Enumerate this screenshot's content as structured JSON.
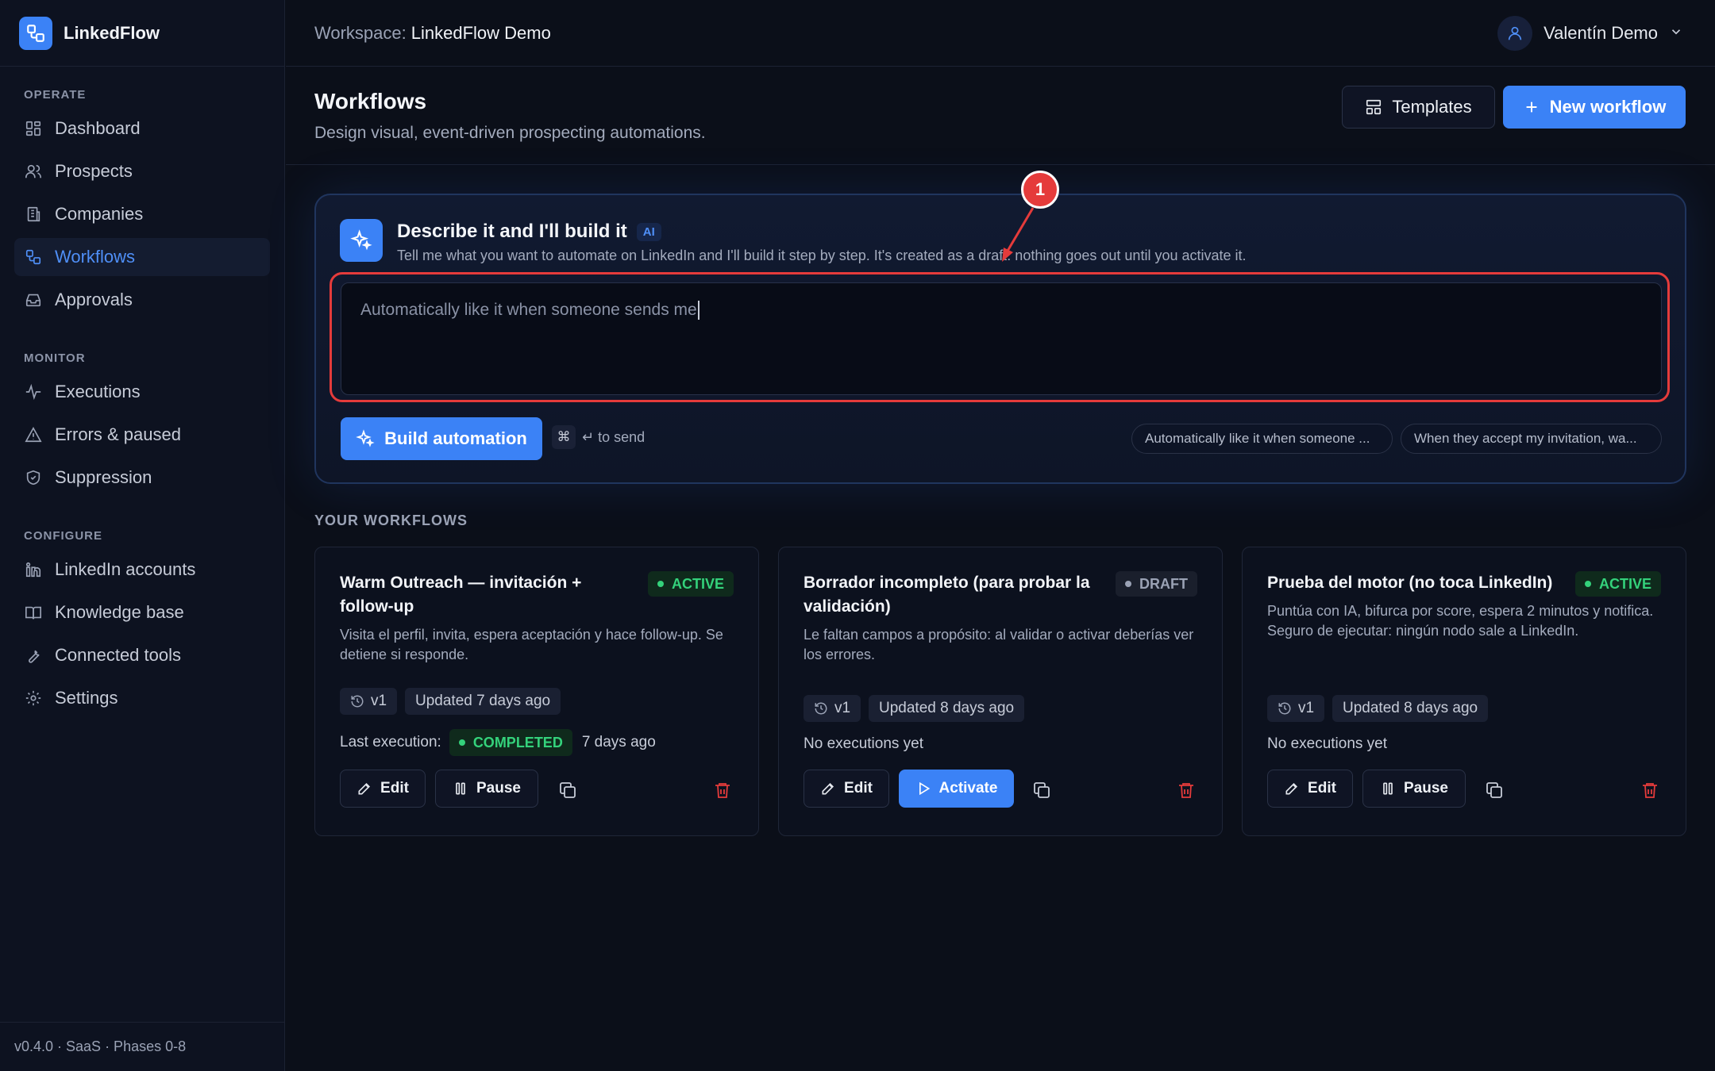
{
  "app": {
    "name": "LinkedFlow"
  },
  "sidebar": {
    "sections": [
      {
        "heading": "OPERATE",
        "items": [
          {
            "label": "Dashboard",
            "icon": "dashboard-icon"
          },
          {
            "label": "Prospects",
            "icon": "users-icon"
          },
          {
            "label": "Companies",
            "icon": "building-icon"
          },
          {
            "label": "Workflows",
            "icon": "workflow-icon",
            "active": true
          },
          {
            "label": "Approvals",
            "icon": "inbox-icon"
          }
        ]
      },
      {
        "heading": "MONITOR",
        "items": [
          {
            "label": "Executions",
            "icon": "activity-icon"
          },
          {
            "label": "Errors & paused",
            "icon": "warning-icon"
          },
          {
            "label": "Suppression",
            "icon": "shield-icon"
          }
        ]
      },
      {
        "heading": "CONFIGURE",
        "items": [
          {
            "label": "LinkedIn accounts",
            "icon": "linkedin-icon"
          },
          {
            "label": "Knowledge base",
            "icon": "book-icon"
          },
          {
            "label": "Connected tools",
            "icon": "wrench-icon"
          },
          {
            "label": "Settings",
            "icon": "gear-icon"
          }
        ]
      }
    ],
    "footer": "v0.4.0 · SaaS · Phases 0-8"
  },
  "topbar": {
    "workspace_label": "Workspace:",
    "workspace_name": "LinkedFlow Demo",
    "user_name": "Valentín Demo"
  },
  "page": {
    "title": "Workflows",
    "subtitle": "Design visual, event-driven prospecting automations.",
    "templates_label": "Templates",
    "new_workflow_label": "New workflow"
  },
  "ai_builder": {
    "title": "Describe it and I'll build it",
    "badge": "AI",
    "description": "Tell me what you want to automate on LinkedIn and I'll build it step by step. It's created as a draft: nothing goes out until you activate it.",
    "input_value": "Automatically like it when someone sends me",
    "build_label": "Build automation",
    "kbd_symbol": "⌘",
    "send_hint": "↵ to send",
    "suggestions": [
      "Automatically like it when someone ...",
      "When they accept my invitation, wa..."
    ]
  },
  "annotation": {
    "number": "1"
  },
  "workflows_section_label": "YOUR WORKFLOWS",
  "workflows": [
    {
      "title": "Warm Outreach — invitación + follow-up",
      "status": "ACTIVE",
      "description": "Visita el perfil, invita, espera aceptación y hace follow-up. Se detiene si responde.",
      "version": "v1",
      "updated": "Updated 7 days ago",
      "last_execution_label": "Last execution:",
      "last_execution_status": "COMPLETED",
      "last_execution_time": "7 days ago",
      "edit_label": "Edit",
      "action_label": "Pause"
    },
    {
      "title": "Borrador incompleto (para probar la validación)",
      "status": "DRAFT",
      "description": "Le faltan campos a propósito: al validar o activar deberías ver los errores.",
      "version": "v1",
      "updated": "Updated 8 days ago",
      "no_exec": "No executions yet",
      "edit_label": "Edit",
      "action_label": "Activate"
    },
    {
      "title": "Prueba del motor (no toca LinkedIn)",
      "status": "ACTIVE",
      "description": "Puntúa con IA, bifurca por score, espera 2 minutos y notifica. Seguro de ejecutar: ningún nodo sale a LinkedIn.",
      "version": "v1",
      "updated": "Updated 8 days ago",
      "no_exec": "No executions yet",
      "edit_label": "Edit",
      "action_label": "Pause"
    }
  ],
  "colors": {
    "accent": "#3b82f6",
    "active": "#34d27b",
    "danger": "#e53b3b",
    "background": "#0b0f19"
  }
}
